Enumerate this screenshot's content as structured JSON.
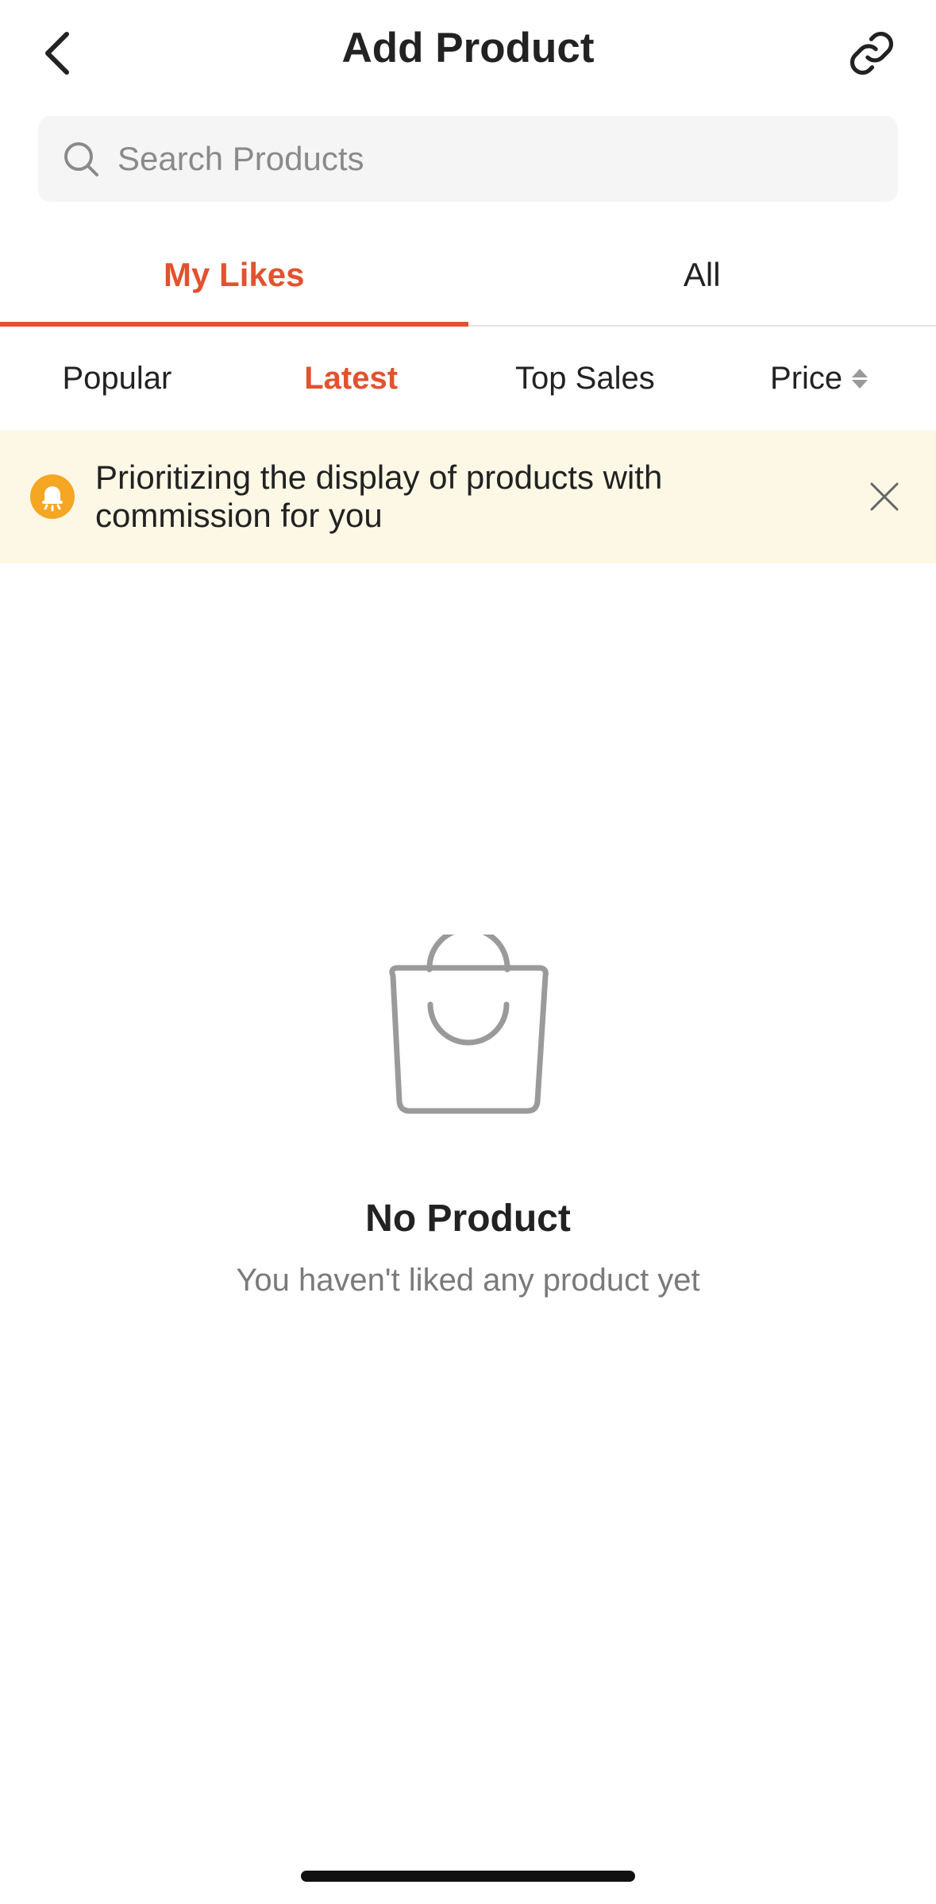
{
  "header": {
    "title": "Add Product",
    "back_icon": "chevron-left-icon",
    "link_icon": "link-icon"
  },
  "search": {
    "placeholder": "Search Products",
    "value": ""
  },
  "tabs": [
    {
      "label": "My Likes",
      "active": true
    },
    {
      "label": "All",
      "active": false
    }
  ],
  "sort_options": [
    {
      "label": "Popular",
      "active": false
    },
    {
      "label": "Latest",
      "active": true
    },
    {
      "label": "Top Sales",
      "active": false
    },
    {
      "label": "Price",
      "active": false,
      "icon": "sort-arrows-icon"
    }
  ],
  "notice": {
    "icon": "bell-icon",
    "text": "Prioritizing the display of products with commission for you",
    "close_icon": "close-icon"
  },
  "empty_state": {
    "icon": "shopping-bag-icon",
    "title": "No Product",
    "subtitle": "You haven't liked any product yet"
  },
  "colors": {
    "accent": "#e2522e",
    "notice_bg": "#fdf8e6",
    "bell": "#f5a623"
  }
}
